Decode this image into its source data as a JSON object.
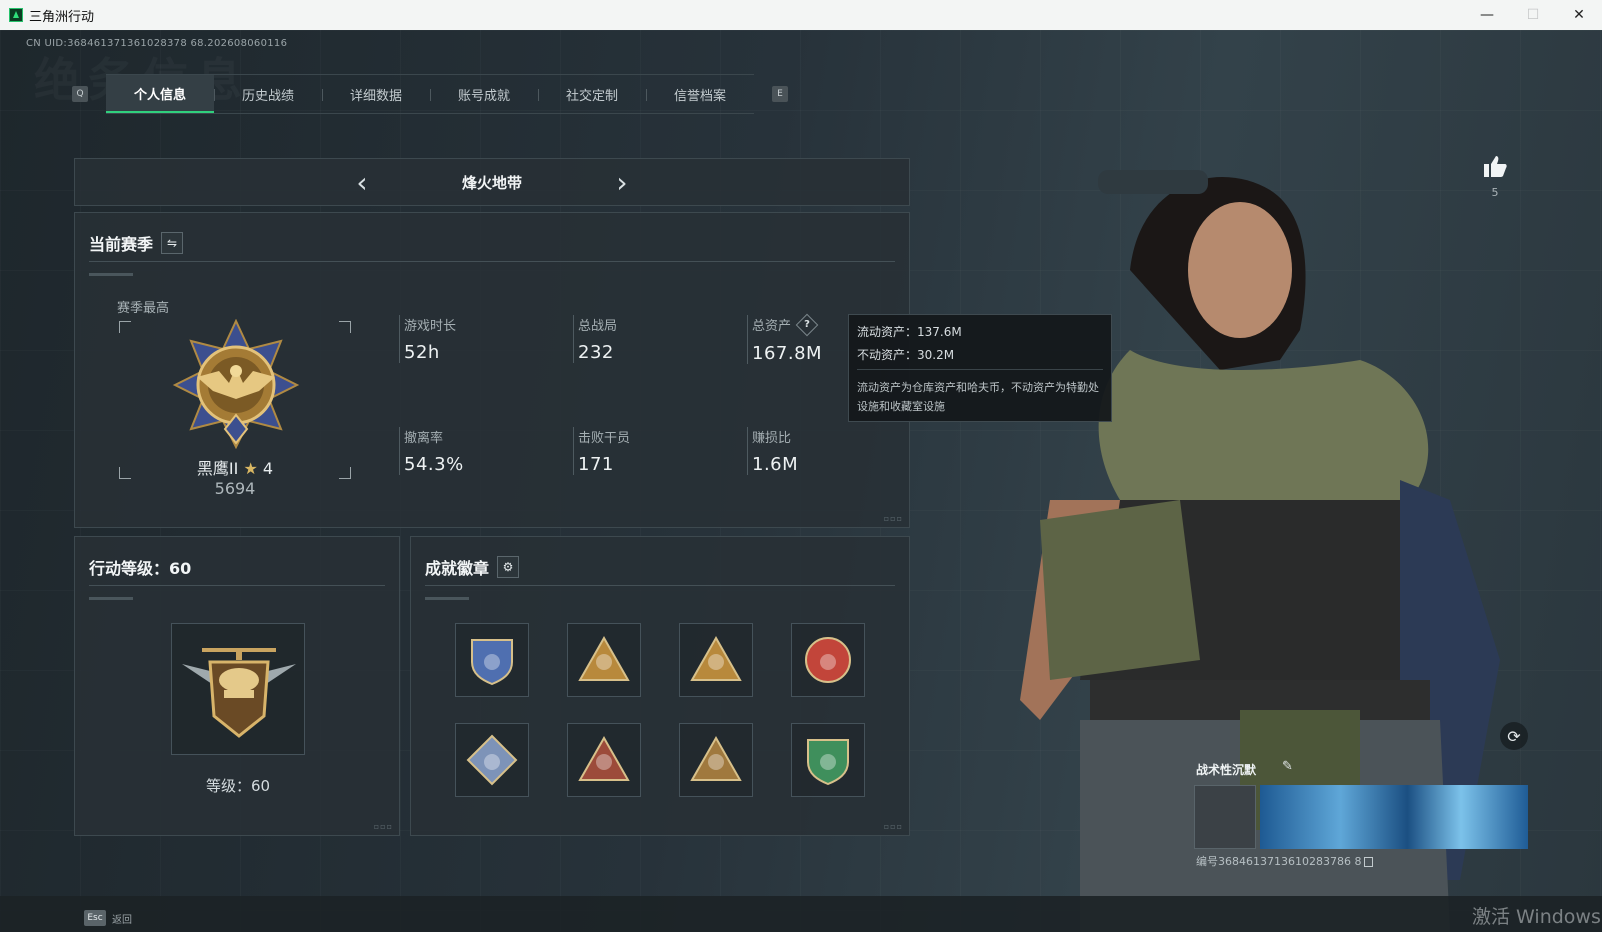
{
  "window": {
    "title": "三角洲行动",
    "controls": [
      "—",
      "☐",
      "✕"
    ]
  },
  "uid_line": "CN UID:368461371361028378 68.202608060116",
  "watermark": "绝务信息",
  "tabs": {
    "left_key": "Q",
    "right_key": "E",
    "items": [
      {
        "label": "个人信息",
        "active": true
      },
      {
        "label": "历史战绩",
        "active": false
      },
      {
        "label": "详细数据",
        "active": false
      },
      {
        "label": "账号成就",
        "active": false
      },
      {
        "label": "社交定制",
        "active": false
      },
      {
        "label": "信誉档案",
        "active": false
      }
    ]
  },
  "mode": {
    "title": "烽火地带",
    "prev": "‹",
    "next": "›"
  },
  "season": {
    "header": "当前赛季",
    "switch_icon": "⇋",
    "best_label": "赛季最高",
    "rank_name": "黑鹰II",
    "rank_stars": "4",
    "rank_score": "5694",
    "stats": [
      {
        "label": "游戏时长",
        "value": "52h"
      },
      {
        "label": "总战局",
        "value": "232"
      },
      {
        "label": "总资产",
        "value": "167.8M",
        "help": "?"
      },
      {
        "label": "撤离率",
        "value": "54.3%"
      },
      {
        "label": "击败干员",
        "value": "171"
      },
      {
        "label": "赚损比",
        "value": "1.6M"
      }
    ]
  },
  "tooltip": {
    "liquid": "流动资产：137.6M",
    "fixed": "不动资产：30.2M",
    "desc": "流动资产为仓库资产和哈夫币，不动资产为特勤处设施和收藏室设施"
  },
  "level": {
    "header": "行动等级：60",
    "level_text": "等级：60"
  },
  "badges": {
    "header": "成就徽章",
    "settings_icon": "gear-icon",
    "items": [
      {
        "icon": "shield-arrows-badge",
        "color": "#4f6fb0"
      },
      {
        "icon": "gold-triangle-badge",
        "color": "#b8893c"
      },
      {
        "icon": "gold-triangle-lion-badge",
        "color": "#b8893c"
      },
      {
        "icon": "star-medal-badge",
        "color": "#c2453a"
      },
      {
        "icon": "crate-diamond-badge",
        "color": "#7d93b8"
      },
      {
        "icon": "wolf-diamond-badge",
        "color": "#9c4b3a"
      },
      {
        "icon": "bronze-shield-badge",
        "color": "#a0793e"
      },
      {
        "icon": "green-shield-badge",
        "color": "#3f8f5c"
      }
    ]
  },
  "profile": {
    "likes": "5",
    "card_title": "战术性沉默",
    "card_id": "编号3684613713610283786 8"
  },
  "bottom": {
    "esc_key": "Esc",
    "esc_label": "返回",
    "activate_text": "激活 Windows"
  }
}
